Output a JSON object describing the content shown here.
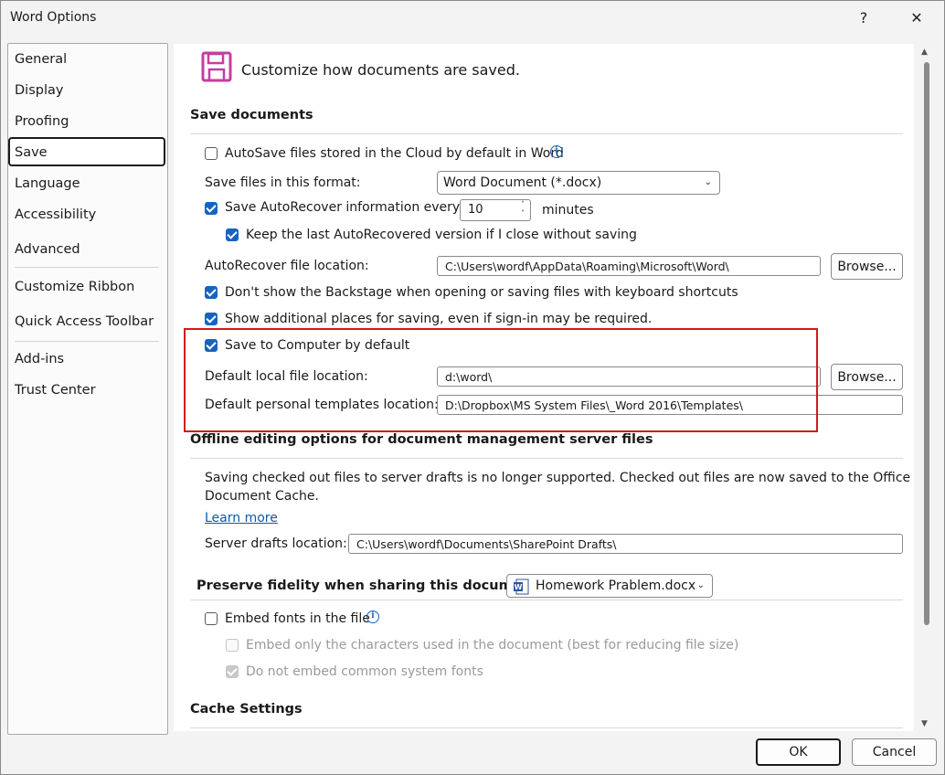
{
  "window": {
    "title": "Word Options",
    "help_label": "?",
    "close_label": "✕"
  },
  "sidebar": {
    "items": [
      {
        "label": "General"
      },
      {
        "label": "Display"
      },
      {
        "label": "Proofing"
      },
      {
        "label": "Save"
      },
      {
        "label": "Language"
      },
      {
        "label": "Accessibility"
      },
      {
        "label": "Advanced"
      },
      {
        "label": "Customize Ribbon"
      },
      {
        "label": "Quick Access Toolbar"
      },
      {
        "label": "Add-ins"
      },
      {
        "label": "Trust Center"
      }
    ],
    "selected": "Save"
  },
  "header": {
    "title": "Customize how documents are saved.",
    "icon": "floppy-disk-icon",
    "icon_color": "#c43ea0"
  },
  "save_documents": {
    "heading": "Save documents",
    "autosave_label": "AutoSave files stored in the Cloud by default in Word",
    "autosave_checked": false,
    "format_label": "Save files in this format:",
    "format_value": "Word Document (*.docx)",
    "autorecover_label": "Save AutoRecover information every",
    "autorecover_checked": true,
    "autorecover_minutes": "10",
    "minutes_label": "minutes",
    "keep_last_label": "Keep the last AutoRecovered version if I close without saving",
    "keep_last_checked": true,
    "ar_location_label": "AutoRecover file location:",
    "ar_location_value": "C:\\Users\\wordf\\AppData\\Roaming\\Microsoft\\Word\\",
    "browse_label": "Browse...",
    "backstage_label": "Don't show the Backstage when opening or saving files with keyboard shortcuts",
    "backstage_checked": true,
    "additional_places_label": "Show additional places for saving, even if sign-in may be required.",
    "additional_places_checked": true,
    "save_computer_label": "Save to Computer by default",
    "save_computer_checked": true,
    "local_location_label": "Default local file location:",
    "local_location_value": "d:\\word\\",
    "templates_label": "Default personal templates location:",
    "templates_value": "D:\\Dropbox\\MS System Files\\_Word 2016\\Templates\\"
  },
  "offline": {
    "heading": "Offline editing options for document management server files",
    "desc_line1": "Saving checked out files to server drafts is no longer supported. Checked out files are now saved to the Office",
    "desc_line2": "Document Cache.",
    "learn_more": "Learn more",
    "drafts_label": "Server drafts location:",
    "drafts_value": "C:\\Users\\wordf\\Documents\\SharePoint Drafts\\"
  },
  "fidelity": {
    "heading": "Preserve fidelity when sharing this document:",
    "doc_value": "Homework Prablem.docx",
    "embed_fonts_label": "Embed fonts in the file",
    "embed_fonts_checked": false,
    "embed_chars_label": "Embed only the characters used in the document (best for reducing file size)",
    "no_common_label": "Do not embed common system fonts"
  },
  "cache": {
    "heading": "Cache Settings"
  },
  "footer": {
    "ok_label": "OK",
    "cancel_label": "Cancel"
  },
  "colors": {
    "accent": "#1764c0",
    "highlight_box": "#d11a1a"
  }
}
